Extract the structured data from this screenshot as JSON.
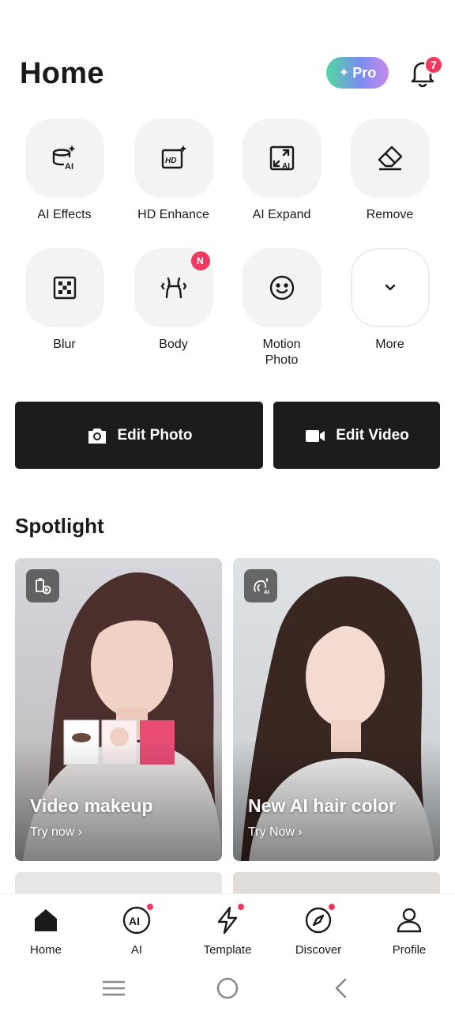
{
  "header": {
    "title": "Home",
    "pro_label": "Pro",
    "notifications_count": "7"
  },
  "tools": [
    {
      "label": "AI Effects",
      "icon": "ai-effects-icon"
    },
    {
      "label": "HD Enhance",
      "icon": "hd-enhance-icon"
    },
    {
      "label": "AI Expand",
      "icon": "ai-expand-icon"
    },
    {
      "label": "Remove",
      "icon": "eraser-icon"
    },
    {
      "label": "Blur",
      "icon": "blur-icon"
    },
    {
      "label": "Body",
      "icon": "body-icon",
      "badge": "N"
    },
    {
      "label": "Motion Photo",
      "icon": "smiley-icon"
    },
    {
      "label": "More",
      "icon": "chevron-down-icon"
    }
  ],
  "actions": {
    "edit_photo": "Edit Photo",
    "edit_video": "Edit Video"
  },
  "spotlight": {
    "title": "Spotlight",
    "cards": [
      {
        "title": "Video makeup",
        "cta": "Try now ›"
      },
      {
        "title": "New AI hair color",
        "cta": "Try Now ›"
      }
    ]
  },
  "bottom_nav": [
    {
      "label": "Home",
      "icon": "home-icon"
    },
    {
      "label": "AI",
      "icon": "ai-icon"
    },
    {
      "label": "Template",
      "icon": "lightning-icon"
    },
    {
      "label": "Discover",
      "icon": "compass-icon"
    },
    {
      "label": "Profile",
      "icon": "person-icon"
    }
  ],
  "colors": {
    "accent": "#f0395e",
    "button_dark": "#1c1c1c"
  }
}
